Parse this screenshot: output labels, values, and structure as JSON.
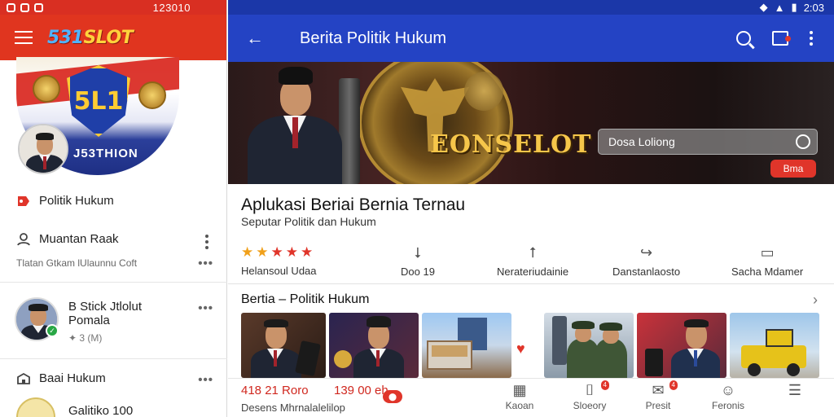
{
  "left_status": {
    "time": "123010"
  },
  "left_header": {
    "brand_main": "531",
    "brand_tail": "SLOT"
  },
  "banner": {
    "shield_text": "5L1",
    "caption": "J53THION"
  },
  "left_nav": {
    "item1": {
      "label": "Politik Hukum",
      "icon": "tag-icon"
    },
    "item2": {
      "label": "Muantan Raak",
      "icon": "person-icon",
      "sub": "Tlatan Gtkam  lUlaunnu  Coft"
    },
    "story": {
      "title": "B  Stick Jtlolut Pomala",
      "meta": "✦ 3 (M)"
    },
    "item3": {
      "label": "Baai Hukum",
      "icon": "store-icon"
    },
    "item4": {
      "label": "Galitiko 100"
    }
  },
  "right_status": {
    "time": "2:03"
  },
  "appbar": {
    "title": "Berita Politik Hukum"
  },
  "hero": {
    "brand": "EONSELOT",
    "search_placeholder": "Dosa Loliong",
    "button_label": "Bma"
  },
  "app_info": {
    "title": "Aplukasi Beriai Bernia Ternau",
    "subtitle": "Seputar Politik dan Hukum",
    "rating_label": "Helansoul Udaa",
    "rating": 5
  },
  "actions": [
    {
      "icon": "⭣",
      "label": "Doo 19"
    },
    {
      "icon": "⭡",
      "label": "Nerateriudainie"
    },
    {
      "icon": "↪",
      "label": "Danstanlaosto"
    },
    {
      "icon": "▭",
      "label": "Sacha Mdamer"
    }
  ],
  "section": {
    "title": "Bertia – Politik Hukum"
  },
  "bottom": {
    "price1": "418 21 Roro",
    "price2": "139 00 eh",
    "pill": "⬤",
    "sub": "Desens  Mhrnalalelilop",
    "tabs": [
      {
        "icon": "▦",
        "label": "Kaoan"
      },
      {
        "icon": "⌷",
        "label": "Sloeory",
        "badge": "4"
      },
      {
        "icon": "✉",
        "label": "Presit",
        "badge": "4"
      },
      {
        "icon": "☺",
        "label": "Feronis"
      },
      {
        "icon": "☰",
        "label": ""
      }
    ]
  }
}
